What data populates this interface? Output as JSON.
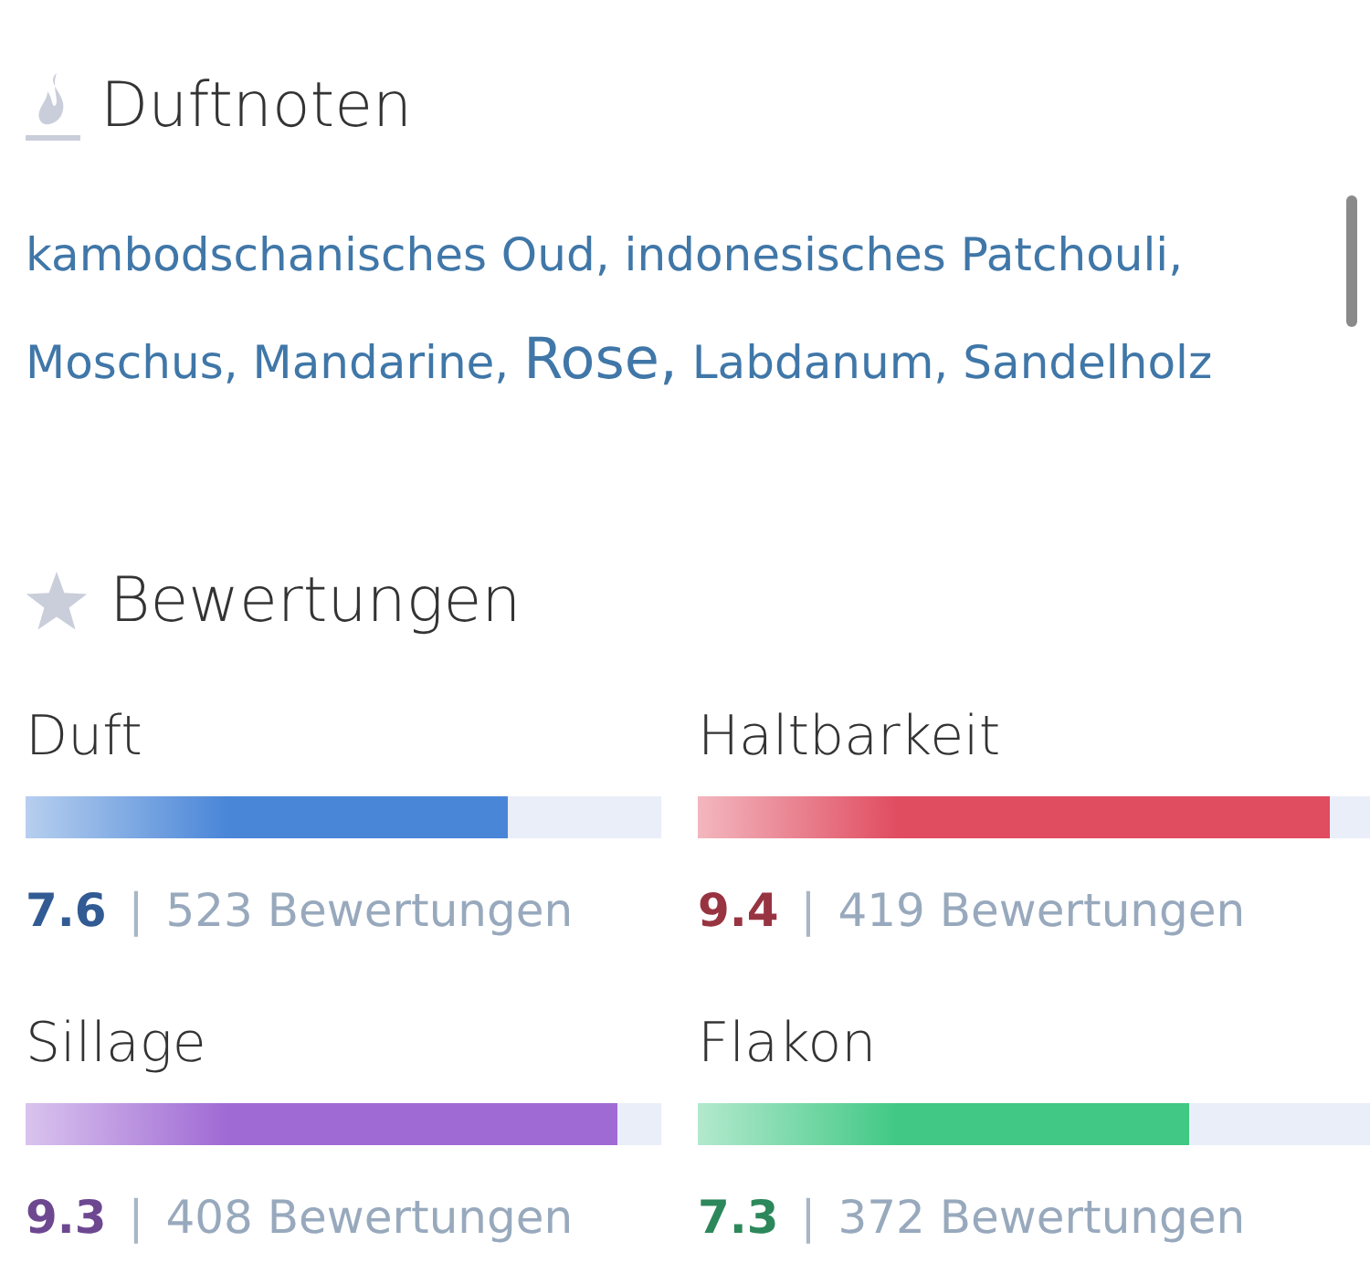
{
  "notes_section": {
    "title": "Duftnoten",
    "notes": [
      {
        "name": "kambodschanisches Oud,",
        "kind": "normal"
      },
      {
        "name": "indonesisches Patchouli,",
        "kind": "normal"
      },
      {
        "name": "Moschus,",
        "kind": "normal"
      },
      {
        "name": "Mandarine,",
        "kind": "normal"
      },
      {
        "name": "Rose,",
        "kind": "large"
      },
      {
        "name": "Labdanum,",
        "kind": "normal"
      },
      {
        "name": "Sandelholz",
        "kind": "normal"
      }
    ]
  },
  "ratings_section": {
    "title": "Bewertungen",
    "ratings": [
      {
        "label": "Duft",
        "level": 0.76,
        "color": "#4a86d8",
        "score": "7.6",
        "separator": "|",
        "count": "523 Bewertungen"
      },
      {
        "label": "Haltbarkeit",
        "level": 0.94,
        "color": "#e04c60",
        "score": "9.4",
        "separator": "|",
        "count": "419 Bewertungen"
      },
      {
        "label": "Sillage",
        "level": 0.93,
        "color": "#a06ad4",
        "score": "9.3",
        "separator": "|",
        "count": "408 Bewertungen"
      },
      {
        "label": "Flakon",
        "level": 0.73,
        "color": "#40c884",
        "score": "7.3",
        "separator": "|",
        "count": "372 Bewertungen"
      }
    ]
  }
}
